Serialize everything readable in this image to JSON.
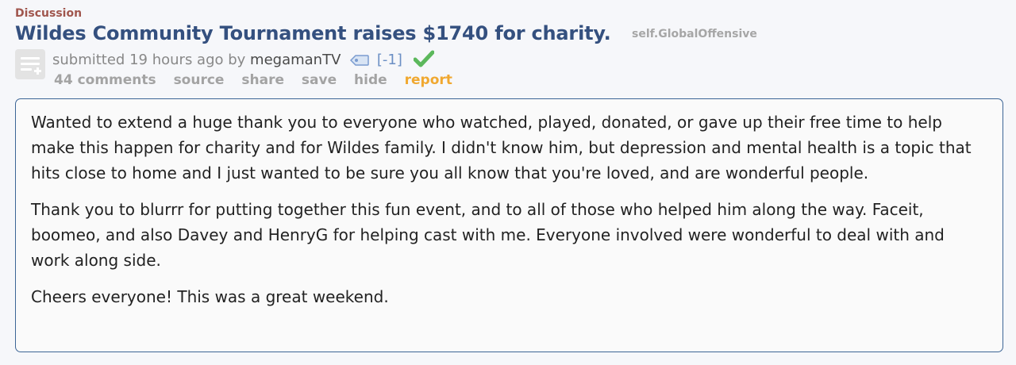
{
  "post": {
    "flair": "Discussion",
    "title": "Wildes Community Tournament raises $1740 for charity.",
    "domain": "self.GlobalOffensive",
    "tagline": {
      "prefix": "submitted 19 hours ago by",
      "author": "megamanTV",
      "score_flag": "[-1]"
    },
    "buttons": {
      "comments": "44 comments",
      "source": "source",
      "share": "share",
      "save": "save",
      "hide": "hide",
      "report": "report"
    },
    "body": [
      "Wanted to extend a huge thank you to everyone who watched, played, donated, or gave up their free time to help make this happen for charity and for Wildes family. I didn't know him, but depression and mental health is a topic that hits close to home and I just wanted to be sure you all know that you're loved, and are wonderful people.",
      "Thank you to blurrr for putting together this fun event, and to all of those who helped him along the way. Faceit, boomeo, and also Davey and HenryG for helping cast with me. Everyone involved were wonderful to deal with and work along side.",
      "Cheers everyone! This was a great weekend."
    ]
  },
  "colors": {
    "title": "#34507f",
    "flair": "#a0564d",
    "report": "#f0a830",
    "body_border": "#3c6596",
    "check": "#5cb85c"
  },
  "icons": {
    "thumbnail": "self-post-icon",
    "tag": "tag-icon",
    "verified": "checkmark-icon"
  }
}
